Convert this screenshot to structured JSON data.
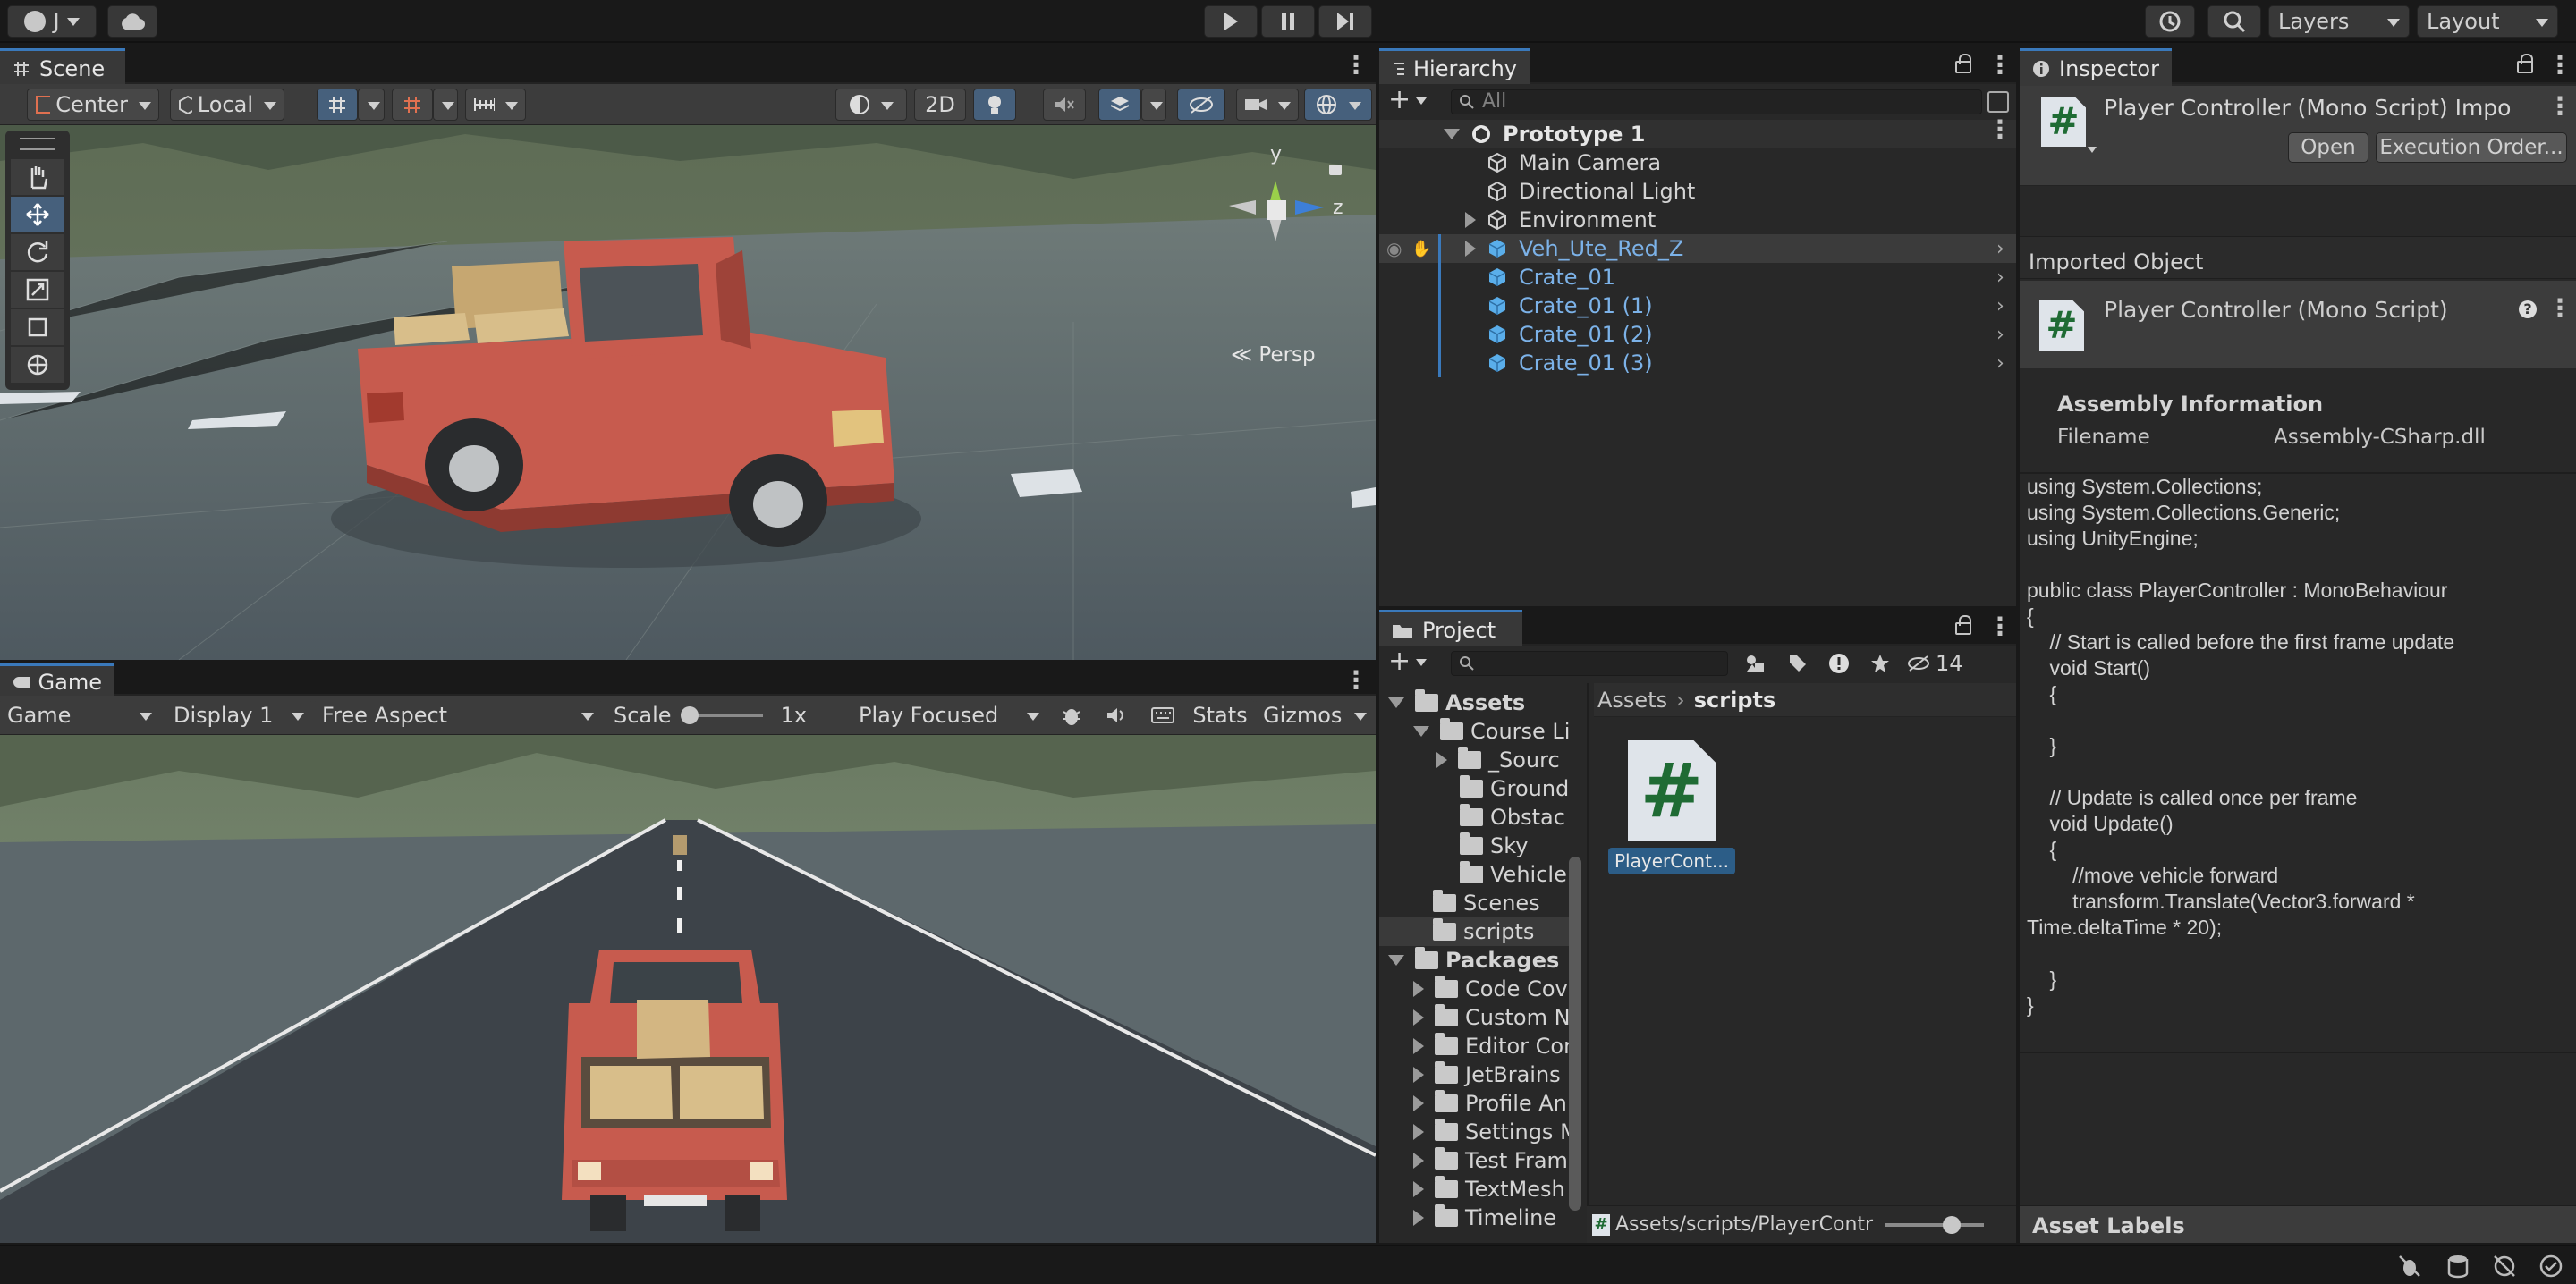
{
  "topbar": {
    "account_label": "J",
    "cloud_icon": "cloud-icon",
    "layers": "Layers",
    "layout": "Layout"
  },
  "scene": {
    "tab": "Scene",
    "pivot": "Center",
    "space": "Local",
    "mode2d": "2D",
    "persp": "Persp",
    "axis_y": "y",
    "axis_z": "z"
  },
  "game": {
    "tab": "Game",
    "view": "Game",
    "display": "Display 1",
    "aspect": "Free Aspect",
    "scale_label": "Scale",
    "scale_value": "1x",
    "play_mode": "Play Focused",
    "stats": "Stats",
    "gizmos": "Gizmos"
  },
  "hierarchy": {
    "tab": "Hierarchy",
    "search_placeholder": "All",
    "items": [
      {
        "label": "Prototype 1"
      },
      {
        "label": "Main Camera"
      },
      {
        "label": "Directional Light"
      },
      {
        "label": "Environment"
      },
      {
        "label": "Veh_Ute_Red_Z"
      },
      {
        "label": "Crate_01"
      },
      {
        "label": "Crate_01 (1)"
      },
      {
        "label": "Crate_01 (2)"
      },
      {
        "label": "Crate_01 (3)"
      }
    ]
  },
  "project": {
    "tab": "Project",
    "hidden_count": "14",
    "breadcrumb_root": "Assets",
    "breadcrumb_leaf": "scripts",
    "tree": [
      "Assets",
      "Course Li",
      "_Sourc",
      "Ground",
      "Obstac",
      "Sky",
      "Vehicle",
      "Scenes",
      "scripts",
      "Packages",
      "Code Cov",
      "Custom N",
      "Editor Cor",
      "JetBrains",
      "Profile An",
      "Settings M",
      "Test Fram",
      "TextMesh",
      "Timeline"
    ],
    "asset_name": "PlayerCont...",
    "path": "Assets/scripts/PlayerContr"
  },
  "inspector": {
    "tab": "Inspector",
    "title": "Player Controller (Mono Script) Impo",
    "open": "Open",
    "execution_order": "Execution Order...",
    "imported_object": "Imported Object",
    "script_title": "Player Controller (Mono Script)",
    "assembly_header": "Assembly Information",
    "filename_label": "Filename",
    "filename_value": "Assembly-CSharp.dll",
    "asset_labels": "Asset Labels",
    "code": "using System.Collections;\nusing System.Collections.Generic;\nusing UnityEngine;\n\npublic class PlayerController : MonoBehaviour\n{\n    // Start is called before the first frame update\n    void Start()\n    {\n\n    }\n\n    // Update is called once per frame\n    void Update()\n    {\n        //move vehicle forward\n        transform.Translate(Vector3.forward *\nTime.deltaTime * 20);\n\n    }\n}"
  }
}
